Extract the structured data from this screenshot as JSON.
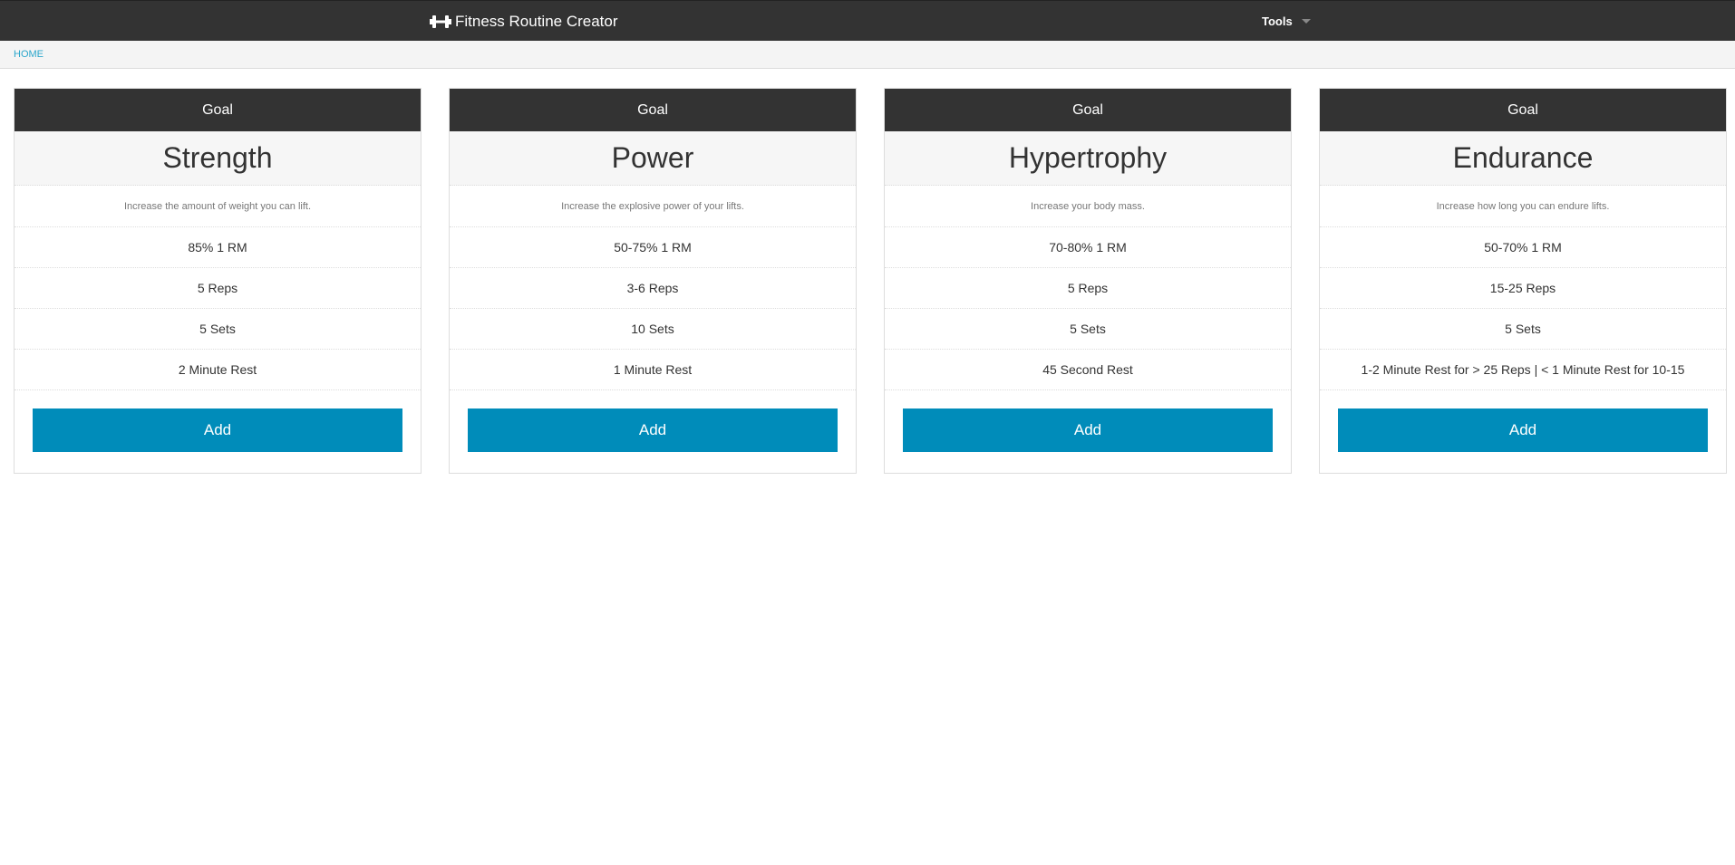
{
  "app": {
    "brand": "Fitness Routine Creator",
    "brand_icon": "dumbbell-icon",
    "tools_label": "Tools"
  },
  "breadcrumb": {
    "home": "HOME"
  },
  "colors": {
    "topbar": "#333333",
    "button": "#008cba",
    "link": "#2ba6cb"
  },
  "cards": [
    {
      "header": "Goal",
      "title": "Strength",
      "description": "Increase the amount of weight you can lift.",
      "intensity": "85% 1 RM",
      "reps": "5 Reps",
      "sets": "5 Sets",
      "rest": "2 Minute Rest",
      "button": "Add"
    },
    {
      "header": "Goal",
      "title": "Power",
      "description": "Increase the explosive power of your lifts.",
      "intensity": "50-75% 1 RM",
      "reps": "3-6 Reps",
      "sets": "10 Sets",
      "rest": "1 Minute Rest",
      "button": "Add"
    },
    {
      "header": "Goal",
      "title": "Hypertrophy",
      "description": "Increase your body mass.",
      "intensity": "70-80% 1 RM",
      "reps": "5 Reps",
      "sets": "5 Sets",
      "rest": "45 Second Rest",
      "button": "Add"
    },
    {
      "header": "Goal",
      "title": "Endurance",
      "description": "Increase how long you can endure lifts.",
      "intensity": "50-70% 1 RM",
      "reps": "15-25 Reps",
      "sets": "5 Sets",
      "rest": "1-2 Minute Rest for > 25 Reps | < 1 Minute Rest for 10-15",
      "button": "Add"
    }
  ]
}
